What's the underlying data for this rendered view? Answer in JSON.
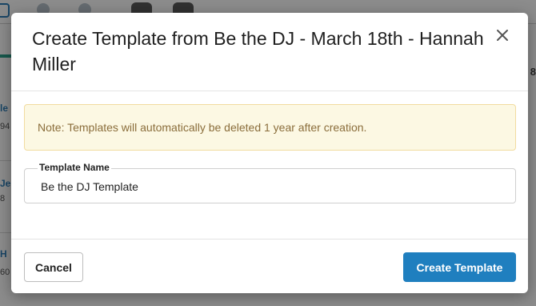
{
  "background": {
    "right_edge_text": "8",
    "left_rows": [
      {
        "title": "le",
        "sub": "94"
      },
      {
        "title": "Je",
        "sub": "8"
      },
      {
        "title": "H",
        "sub": "60"
      }
    ]
  },
  "modal": {
    "title": "Create Template from Be the DJ - March 18th - Hannah Miller",
    "note": "Note: Templates will automatically be deleted 1 year after creation.",
    "field": {
      "label": "Template Name",
      "value": "Be the DJ Template"
    },
    "cancel_label": "Cancel",
    "create_label": "Create Template"
  },
  "colors": {
    "primary": "#1f7fbf",
    "note_bg": "#fcf8e3",
    "note_text": "#8a6d3b"
  }
}
